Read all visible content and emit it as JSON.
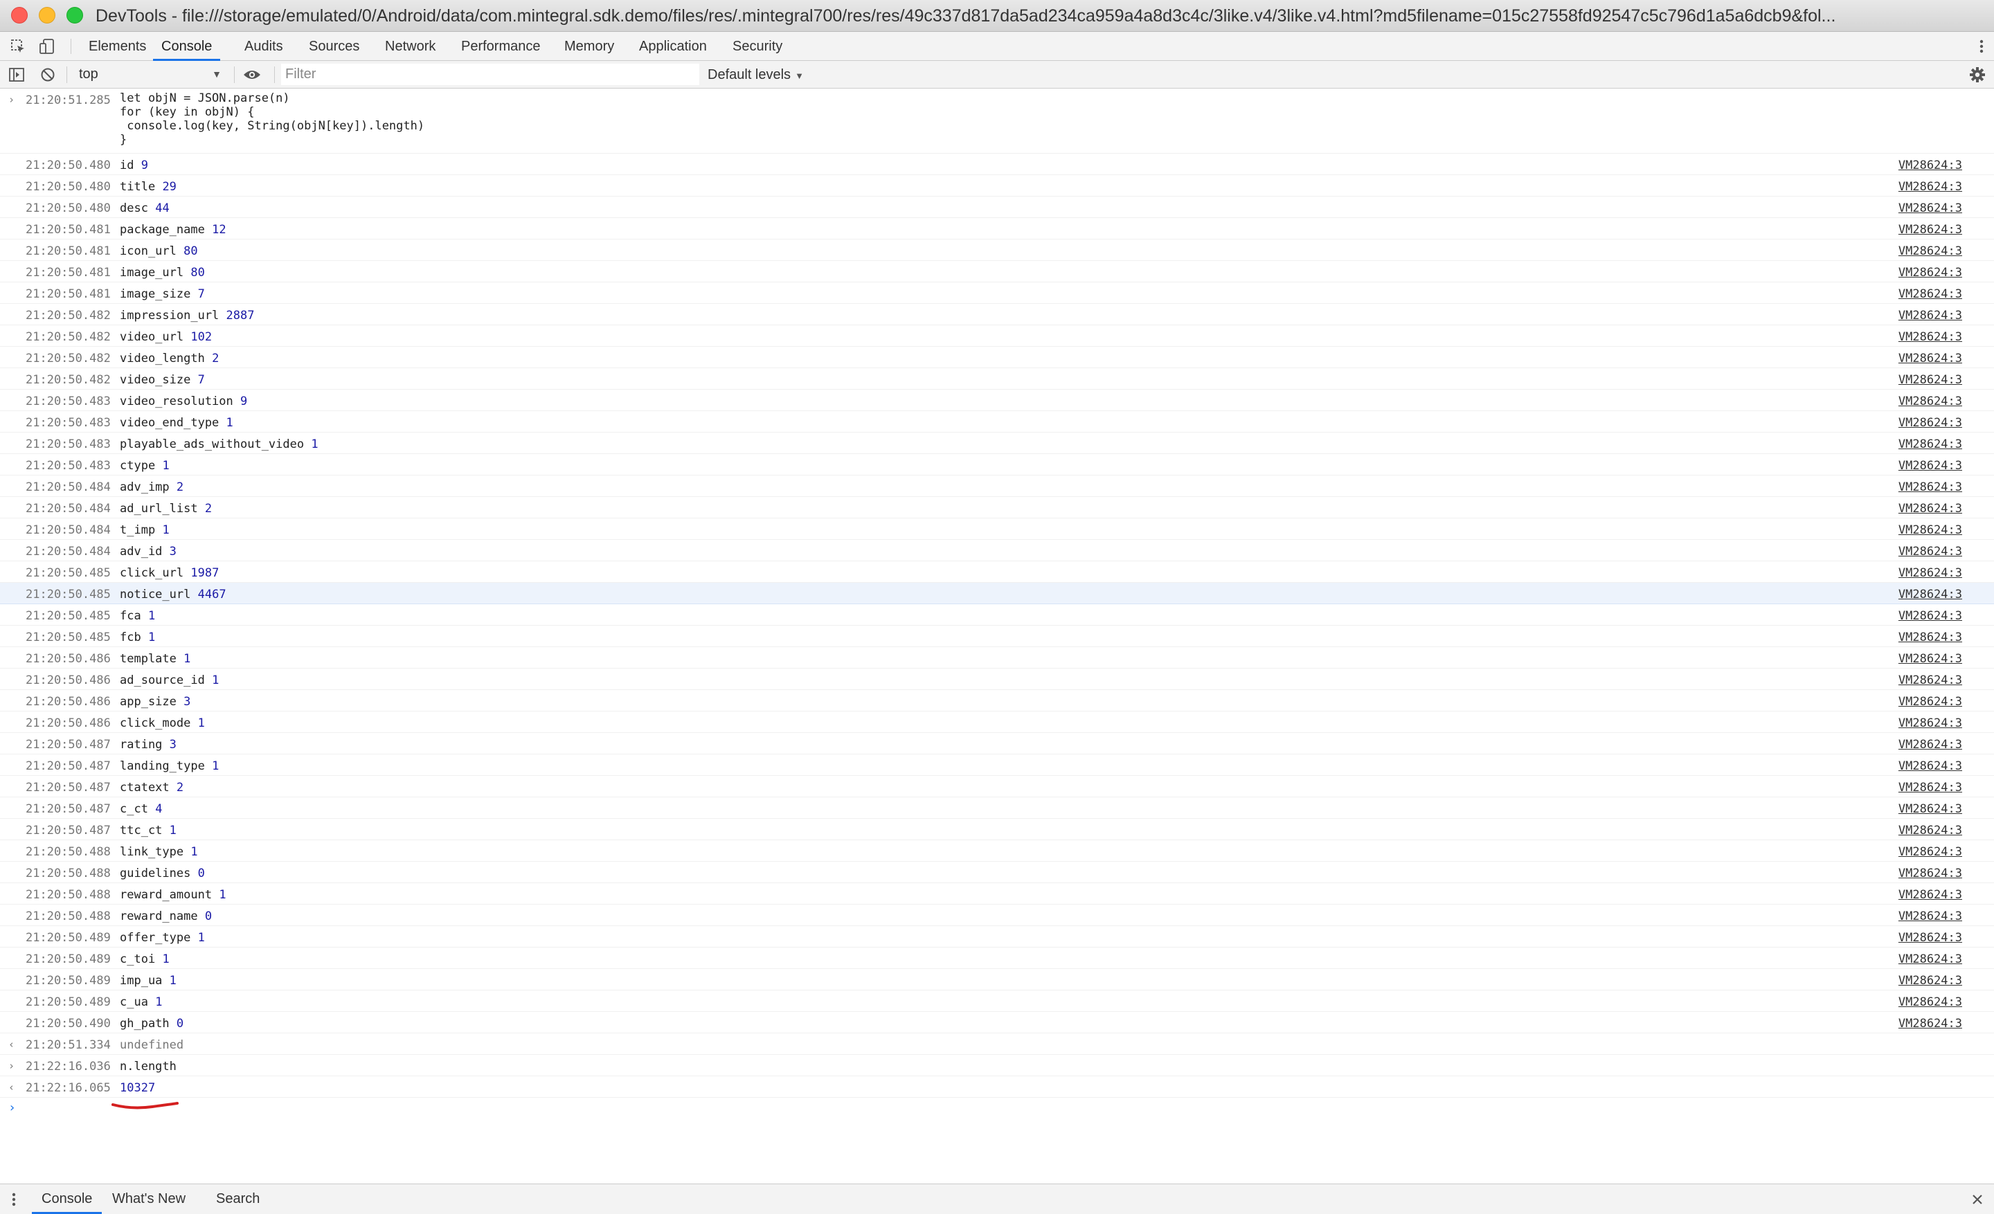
{
  "window": {
    "title": "DevTools - file:///storage/emulated/0/Android/data/com.mintegral.sdk.demo/files/res/.mintegral700/res/res/49c337d817da5ad234ca959a4a8d3c4c/3like.v4/3like.v4.html?md5filename=015c27558fd92547c5c796d1a5a6dcb9&fol..."
  },
  "tabs": [
    "Elements",
    "Console",
    "Audits",
    "Sources",
    "Network",
    "Performance",
    "Memory",
    "Application",
    "Security"
  ],
  "active_tab": "Console",
  "toolbar": {
    "context": "top",
    "filter_placeholder": "Filter",
    "levels": "Default levels"
  },
  "console": {
    "command": {
      "ts": "21:20:51.285",
      "lines": [
        "let objN = JSON.parse(n)",
        "for (key in objN) {",
        " console.log(key, String(objN[key]).length)",
        "}"
      ]
    },
    "logs": [
      {
        "ts": "21:20:50.480",
        "key": "id",
        "val": "9",
        "src": "VM28624:3"
      },
      {
        "ts": "21:20:50.480",
        "key": "title",
        "val": "29",
        "src": "VM28624:3"
      },
      {
        "ts": "21:20:50.480",
        "key": "desc",
        "val": "44",
        "src": "VM28624:3"
      },
      {
        "ts": "21:20:50.481",
        "key": "package_name",
        "val": "12",
        "src": "VM28624:3"
      },
      {
        "ts": "21:20:50.481",
        "key": "icon_url",
        "val": "80",
        "src": "VM28624:3"
      },
      {
        "ts": "21:20:50.481",
        "key": "image_url",
        "val": "80",
        "src": "VM28624:3"
      },
      {
        "ts": "21:20:50.481",
        "key": "image_size",
        "val": "7",
        "src": "VM28624:3"
      },
      {
        "ts": "21:20:50.482",
        "key": "impression_url",
        "val": "2887",
        "src": "VM28624:3"
      },
      {
        "ts": "21:20:50.482",
        "key": "video_url",
        "val": "102",
        "src": "VM28624:3"
      },
      {
        "ts": "21:20:50.482",
        "key": "video_length",
        "val": "2",
        "src": "VM28624:3"
      },
      {
        "ts": "21:20:50.482",
        "key": "video_size",
        "val": "7",
        "src": "VM28624:3"
      },
      {
        "ts": "21:20:50.483",
        "key": "video_resolution",
        "val": "9",
        "src": "VM28624:3"
      },
      {
        "ts": "21:20:50.483",
        "key": "video_end_type",
        "val": "1",
        "src": "VM28624:3"
      },
      {
        "ts": "21:20:50.483",
        "key": "playable_ads_without_video",
        "val": "1",
        "src": "VM28624:3"
      },
      {
        "ts": "21:20:50.483",
        "key": "ctype",
        "val": "1",
        "src": "VM28624:3"
      },
      {
        "ts": "21:20:50.484",
        "key": "adv_imp",
        "val": "2",
        "src": "VM28624:3"
      },
      {
        "ts": "21:20:50.484",
        "key": "ad_url_list",
        "val": "2",
        "src": "VM28624:3"
      },
      {
        "ts": "21:20:50.484",
        "key": "t_imp",
        "val": "1",
        "src": "VM28624:3"
      },
      {
        "ts": "21:20:50.484",
        "key": "adv_id",
        "val": "3",
        "src": "VM28624:3"
      },
      {
        "ts": "21:20:50.485",
        "key": "click_url",
        "val": "1987",
        "src": "VM28624:3"
      },
      {
        "ts": "21:20:50.485",
        "key": "notice_url",
        "val": "4467",
        "src": "VM28624:3"
      },
      {
        "ts": "21:20:50.485",
        "key": "fca",
        "val": "1",
        "src": "VM28624:3"
      },
      {
        "ts": "21:20:50.485",
        "key": "fcb",
        "val": "1",
        "src": "VM28624:3"
      },
      {
        "ts": "21:20:50.486",
        "key": "template",
        "val": "1",
        "src": "VM28624:3"
      },
      {
        "ts": "21:20:50.486",
        "key": "ad_source_id",
        "val": "1",
        "src": "VM28624:3"
      },
      {
        "ts": "21:20:50.486",
        "key": "app_size",
        "val": "3",
        "src": "VM28624:3"
      },
      {
        "ts": "21:20:50.486",
        "key": "click_mode",
        "val": "1",
        "src": "VM28624:3"
      },
      {
        "ts": "21:20:50.487",
        "key": "rating",
        "val": "3",
        "src": "VM28624:3"
      },
      {
        "ts": "21:20:50.487",
        "key": "landing_type",
        "val": "1",
        "src": "VM28624:3"
      },
      {
        "ts": "21:20:50.487",
        "key": "ctatext",
        "val": "2",
        "src": "VM28624:3"
      },
      {
        "ts": "21:20:50.487",
        "key": "c_ct",
        "val": "4",
        "src": "VM28624:3"
      },
      {
        "ts": "21:20:50.487",
        "key": "ttc_ct",
        "val": "1",
        "src": "VM28624:3"
      },
      {
        "ts": "21:20:50.488",
        "key": "link_type",
        "val": "1",
        "src": "VM28624:3"
      },
      {
        "ts": "21:20:50.488",
        "key": "guidelines",
        "val": "0",
        "src": "VM28624:3"
      },
      {
        "ts": "21:20:50.488",
        "key": "reward_amount",
        "val": "1",
        "src": "VM28624:3"
      },
      {
        "ts": "21:20:50.488",
        "key": "reward_name",
        "val": "0",
        "src": "VM28624:3"
      },
      {
        "ts": "21:20:50.489",
        "key": "offer_type",
        "val": "1",
        "src": "VM28624:3"
      },
      {
        "ts": "21:20:50.489",
        "key": "c_toi",
        "val": "1",
        "src": "VM28624:3"
      },
      {
        "ts": "21:20:50.489",
        "key": "imp_ua",
        "val": "1",
        "src": "VM28624:3"
      },
      {
        "ts": "21:20:50.489",
        "key": "c_ua",
        "val": "1",
        "src": "VM28624:3"
      },
      {
        "ts": "21:20:50.490",
        "key": "gh_path",
        "val": "0",
        "src": "VM28624:3"
      }
    ],
    "result1": {
      "ts": "21:20:51.334",
      "text": "undefined"
    },
    "command2": {
      "ts": "21:22:16.036",
      "text": "n.length"
    },
    "result2": {
      "ts": "21:22:16.065",
      "text": "10327"
    }
  },
  "drawer": {
    "tabs": [
      "Console",
      "What's New",
      "Search"
    ],
    "active": "Console"
  },
  "colors": {
    "accent": "#1a73e8",
    "number": "#1a1aa6",
    "annotation": "#d42020",
    "highlight_row": "#edf3fc"
  },
  "icons": [
    "inspect-element-icon",
    "device-toggle-icon",
    "kebab-menu-icon",
    "sidebar-toggle-icon",
    "clear-console-icon",
    "eye-icon",
    "gear-icon",
    "close-icon"
  ]
}
